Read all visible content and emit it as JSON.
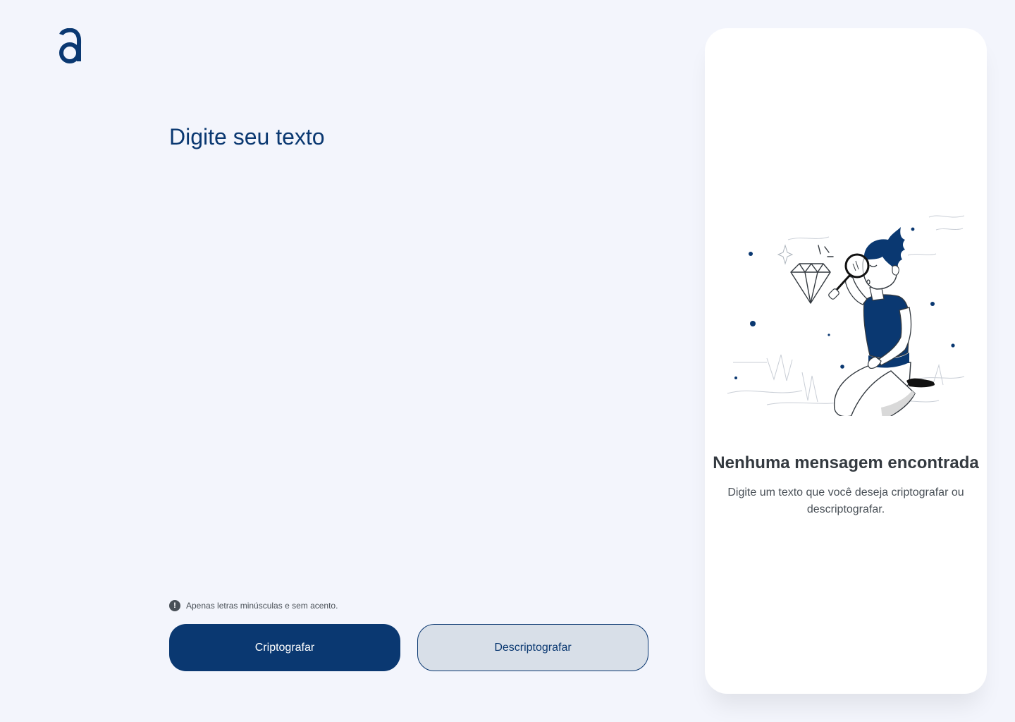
{
  "app": {
    "logo_icon": "alura-a-logo-icon"
  },
  "editor": {
    "placeholder": "Digite seu texto",
    "value": ""
  },
  "hint": {
    "icon": "exclamation-circle-icon",
    "text": "Apenas letras minúsculas e sem acento."
  },
  "actions": {
    "encrypt_label": "Criptografar",
    "decrypt_label": "Descriptografar"
  },
  "output_panel": {
    "illustration": "person-magnifying-glass-diamond-illustration",
    "empty_title": "Nenhuma mensagem encontrada",
    "empty_description": "Digite um texto que você deseja criptografar ou descriptografar."
  },
  "colors": {
    "background": "#f3f5fc",
    "primary": "#0a3871",
    "secondary_button_bg": "#d8dfe8",
    "panel_bg": "#ffffff",
    "title_text": "#343a40",
    "body_text": "#495057"
  }
}
